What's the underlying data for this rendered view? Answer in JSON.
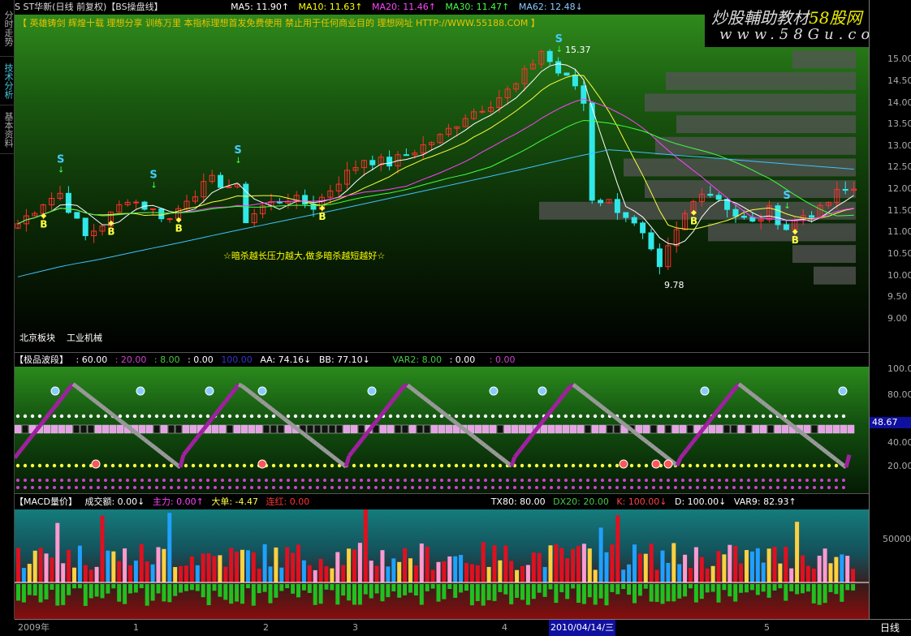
{
  "topbar": {
    "title": "S ST华新(日线 前复权)【BS操盘线】",
    "ma5": "MA5: 11.90↑",
    "ma10": "MA10: 11.63↑",
    "ma20": "MA20: 11.46↑",
    "ma30": "MA30: 11.47↑",
    "ma62": "MA62: 12.48↓"
  },
  "banner": "【 英雄铸剑  辉煌十载  理想分享  训练万里  本指标理想首发免费使用  禁止用于任何商业目的  理想网址 HTTP://WWW.55188.COM 】",
  "sidebar": {
    "tabs": [
      "分时走势",
      "技术分析",
      "基本资料"
    ]
  },
  "logo": {
    "line1": "炒股輔助教材",
    "line1b": "58股网",
    "line2": "www.58Gu.com"
  },
  "main": {
    "note": "☆暗杀越长压力越大,做多暗杀越短越好☆",
    "sector1": "北京板块",
    "sector2": "工业机械",
    "high_label": "15.37",
    "low_label": "9.78",
    "signal_s": "S",
    "signal_b": "B"
  },
  "panel2": {
    "title": "【极品波段】",
    "v1": ": 60.00",
    "v2": ": 20.00",
    "v3": ": 8.00",
    "v4": ": 0.00",
    "v5": "100.00",
    "aa": "AA: 74.16↓",
    "bb": "BB: 77.10↓",
    "var2": "VAR2: 8.00",
    "v6": ": 0.00",
    "v7": ": 0.00",
    "current": "48.67"
  },
  "panel3": {
    "title": "【MACD量价】",
    "vol": "成交额: 0.00↓",
    "zl": "主力: 0.00↑",
    "dd": "大单: -4.47",
    "lh": "连红: 0.00",
    "tx80": "TX80: 80.00",
    "dx20": "DX20: 20.00",
    "k": "K: 100.00↓",
    "d": "D: 100.00↓",
    "var9": "VAR9: 82.93↑"
  },
  "price_axis": [
    "15.00",
    "14.50",
    "14.00",
    "13.50",
    "13.00",
    "12.50",
    "12.00",
    "11.50",
    "11.00",
    "10.50",
    "10.00",
    "9.50",
    "9.00"
  ],
  "osc_axis": [
    "100.00",
    "80.00",
    "40.00",
    "20.00"
  ],
  "vol_axis": [
    "50000"
  ],
  "time_axis": {
    "labels": [
      "2009年",
      "1",
      "2",
      "3",
      "4",
      "5"
    ],
    "cursor": "2010/04/14/三",
    "period": "日线"
  },
  "colors": {
    "up": "#ff3030",
    "down": "#30e8e8",
    "ma5": "#ffffff",
    "ma10": "#ffff40",
    "ma20": "#ff40ff",
    "ma30": "#40ff40",
    "ma62": "#40c0ff"
  },
  "chart_data": {
    "type": "candlestick",
    "anchors": [
      [
        0,
        11.2
      ],
      [
        3,
        11.7
      ],
      [
        5,
        11.9
      ],
      [
        8,
        10.9
      ],
      [
        10,
        11.2
      ],
      [
        13,
        11.8
      ],
      [
        15,
        11.6
      ],
      [
        18,
        11.3
      ],
      [
        20,
        11.8
      ],
      [
        23,
        12.2
      ],
      [
        26,
        12.0
      ],
      [
        27,
        11.3
      ],
      [
        29,
        11.6
      ],
      [
        32,
        11.8
      ],
      [
        35,
        11.6
      ],
      [
        38,
        12.2
      ],
      [
        41,
        12.7
      ],
      [
        44,
        12.6
      ],
      [
        47,
        12.9
      ],
      [
        50,
        13.2
      ],
      [
        53,
        13.7
      ],
      [
        56,
        14.0
      ],
      [
        59,
        14.4
      ],
      [
        62,
        15.2
      ],
      [
        64,
        14.7
      ],
      [
        66,
        14.4
      ],
      [
        67,
        14.0
      ],
      [
        68,
        11.8
      ],
      [
        70,
        11.7
      ],
      [
        72,
        11.4
      ],
      [
        74,
        10.9
      ],
      [
        76,
        10.1
      ],
      [
        77,
        10.6
      ],
      [
        79,
        11.4
      ],
      [
        81,
        12.0
      ],
      [
        83,
        11.8
      ],
      [
        85,
        11.4
      ],
      [
        87,
        11.2
      ],
      [
        89,
        11.5
      ],
      [
        91,
        11.1
      ],
      [
        93,
        11.4
      ],
      [
        95,
        11.5
      ],
      [
        97,
        11.9
      ],
      [
        99,
        12.0
      ]
    ],
    "ylim": [
      9.0,
      15.0
    ],
    "signals_s": [
      5,
      16,
      26,
      64,
      91
    ],
    "signals_b": [
      3,
      11,
      19,
      36,
      80,
      92
    ],
    "pressure_levels": [
      [
        15.0,
        0.3
      ],
      [
        14.5,
        0.9
      ],
      [
        14.0,
        1.0
      ],
      [
        13.5,
        0.85
      ],
      [
        13.0,
        0.95
      ],
      [
        12.5,
        1.1
      ],
      [
        12.0,
        1.0
      ],
      [
        11.5,
        1.5
      ],
      [
        11.0,
        0.7
      ],
      [
        10.5,
        0.3
      ],
      [
        10.0,
        0.2
      ]
    ]
  }
}
